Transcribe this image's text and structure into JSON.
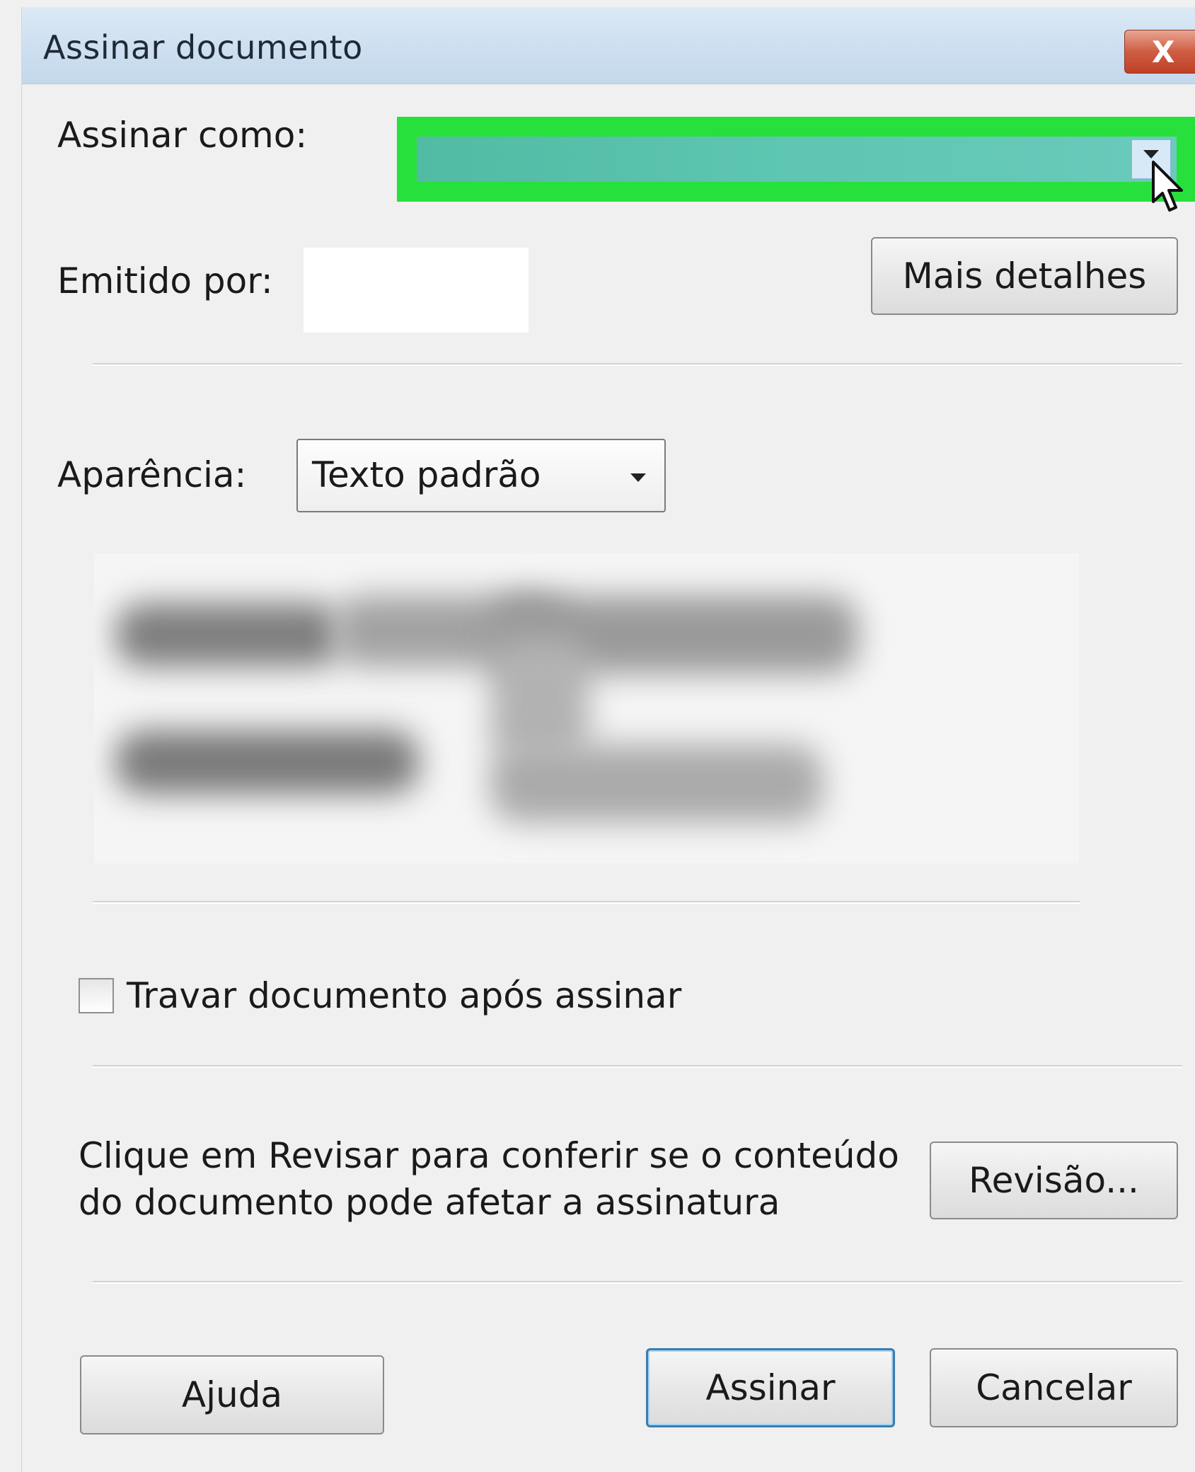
{
  "dialog": {
    "title": "Assinar documento",
    "close_label": "X"
  },
  "sign_as": {
    "label": "Assinar como:"
  },
  "issued_by": {
    "label": "Emitido por:",
    "more_details_button": "Mais detalhes"
  },
  "appearance": {
    "label": "Aparência:",
    "selected": "Texto padrão"
  },
  "lock": {
    "label": "Travar documento após assinar",
    "checked": false
  },
  "review": {
    "text_line1": "Clique em Revisar para conferir se o conteúdo",
    "text_line2": "do documento pode afetar a assinatura",
    "button": "Revisão..."
  },
  "footer": {
    "help_button": "Ajuda",
    "sign_button": "Assinar",
    "cancel_button": "Cancelar"
  },
  "colors": {
    "highlight": "#28e03c",
    "title_bar": "#cddff0",
    "close_button": "#cf5d43"
  }
}
